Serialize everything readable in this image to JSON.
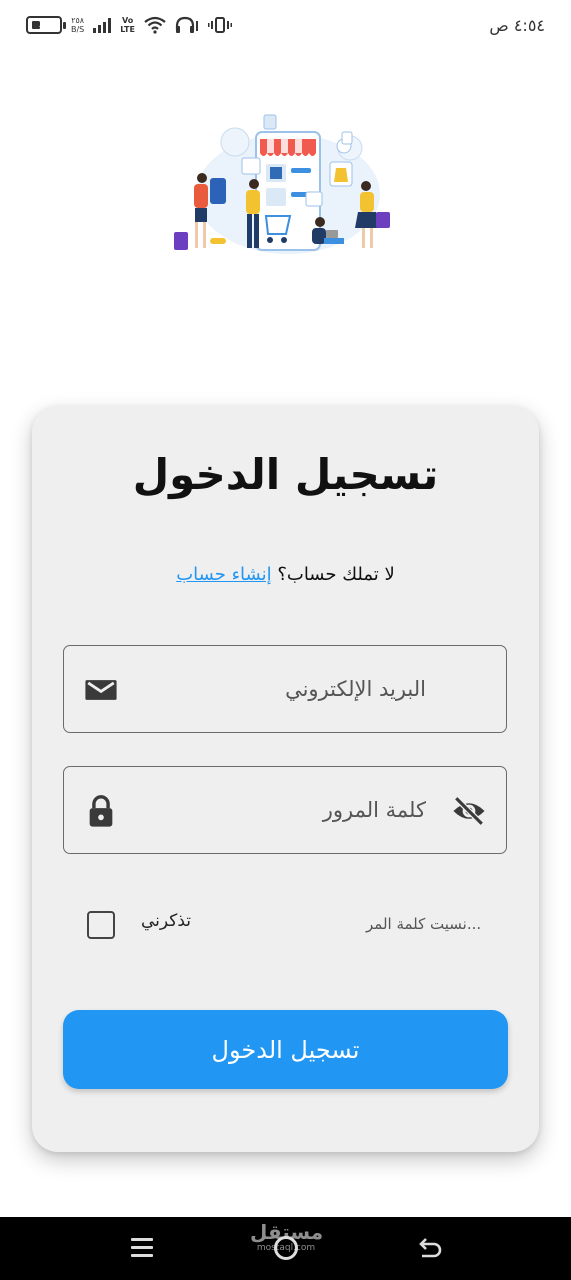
{
  "status_bar": {
    "battery_level": "15",
    "net_speed_value": "٢٥٨",
    "net_speed_unit": "B/S",
    "volte_top": "Vo",
    "volte_bottom": "LTE",
    "time": "٤:٥٤ ص"
  },
  "login": {
    "title": "تسجيل الدخول",
    "no_account_text": "لا تملك حساب؟",
    "create_account_link": "إنشاء حساب",
    "email_placeholder": "البريد الإلكتروني",
    "password_placeholder": "كلمة المرور",
    "remember_me": "تذكرني",
    "forgot_password": "...نسيت كلمة المر",
    "submit_label": "تسجيل الدخول"
  },
  "icons": {
    "email": "envelope-icon",
    "password": "lock-icon",
    "visibility": "eye-off-icon"
  },
  "navigation": {
    "watermark_main": "مستقل",
    "watermark_sub": "mostaql.com"
  },
  "colors": {
    "accent": "#2196f3",
    "card_background": "#efefef",
    "nav_bar": "#000000"
  }
}
